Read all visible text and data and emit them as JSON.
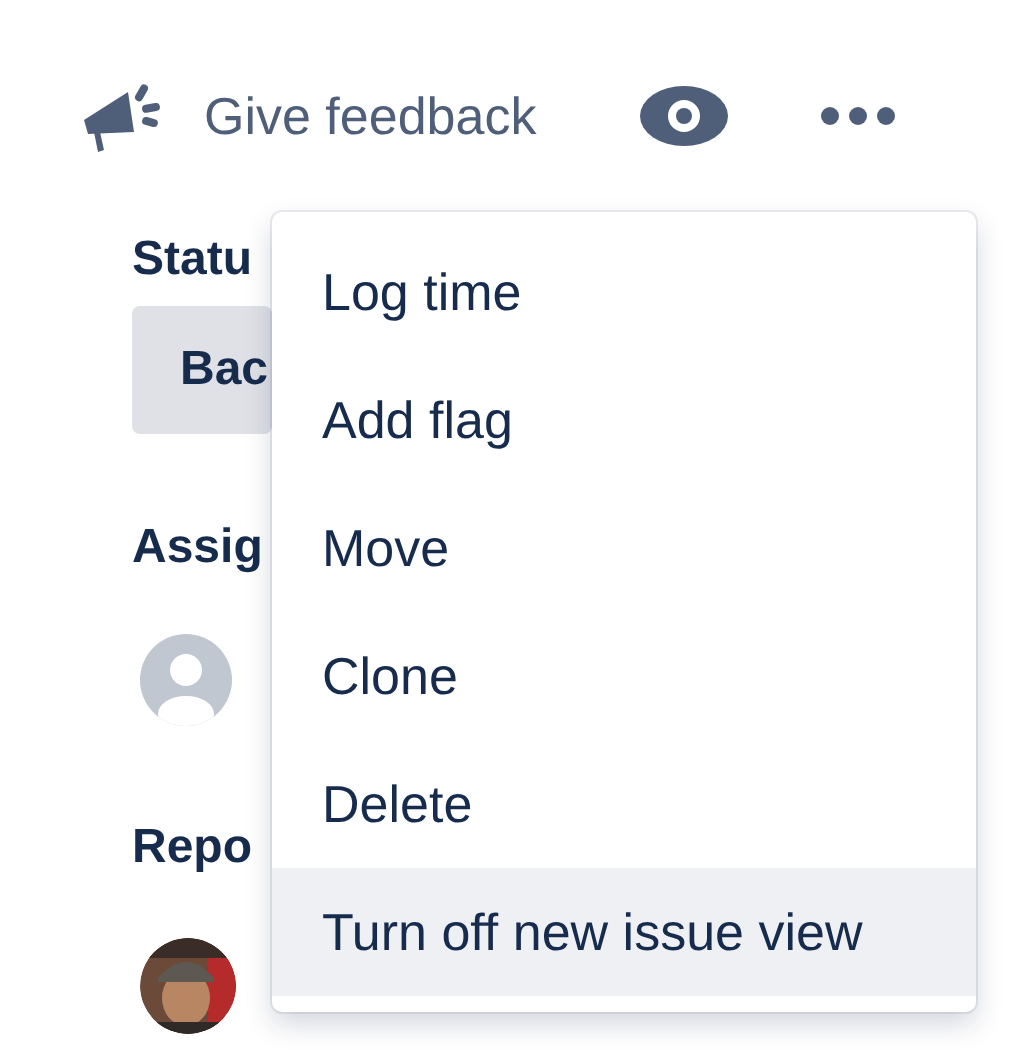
{
  "toolbar": {
    "feedback": {
      "label": "Give feedback"
    }
  },
  "fields": [
    {
      "kind": "label",
      "text": "Statu"
    },
    {
      "kind": "status",
      "text": "Bac"
    },
    {
      "kind": "label",
      "text": "Assig"
    },
    {
      "kind": "avatar"
    },
    {
      "kind": "label",
      "text": "Repo"
    },
    {
      "kind": "picture"
    }
  ],
  "menu": {
    "items": [
      {
        "label": "Log time",
        "selected": false
      },
      {
        "label": "Add flag",
        "selected": false
      },
      {
        "label": "Move",
        "selected": false
      },
      {
        "label": "Clone",
        "selected": false
      },
      {
        "label": "Delete",
        "selected": false
      },
      {
        "label": "Turn off new issue view",
        "selected": true
      }
    ]
  }
}
